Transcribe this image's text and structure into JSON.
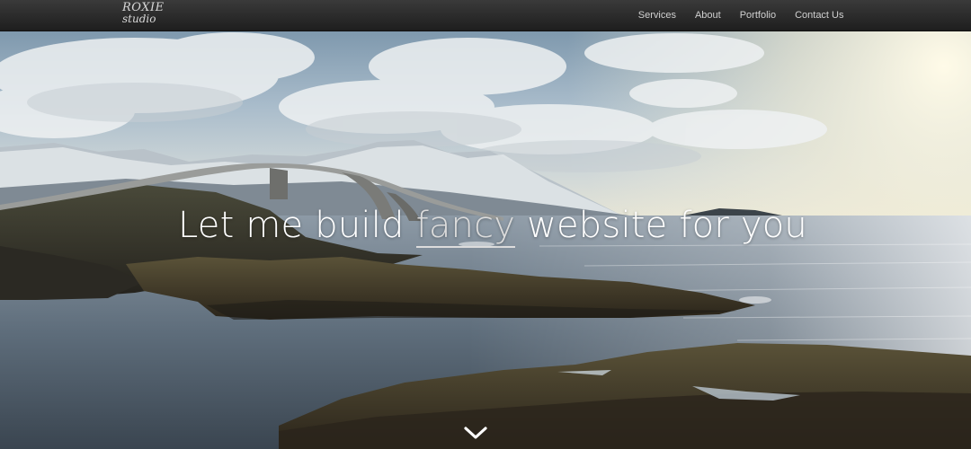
{
  "brand": {
    "line1": "ROXIE",
    "line2": "studio"
  },
  "nav": {
    "items": [
      {
        "label": "Services"
      },
      {
        "label": "About"
      },
      {
        "label": "Portfolio"
      },
      {
        "label": "Contact Us"
      }
    ]
  },
  "hero": {
    "headline_before": "Let me build ",
    "headline_accent": "fancy",
    "headline_after": " website for you",
    "scroll_icon": "chevron-down-icon"
  },
  "colors": {
    "navbar": "#2a2a2a",
    "nav_text": "#d0d0d0",
    "headline": "#ffffff"
  }
}
